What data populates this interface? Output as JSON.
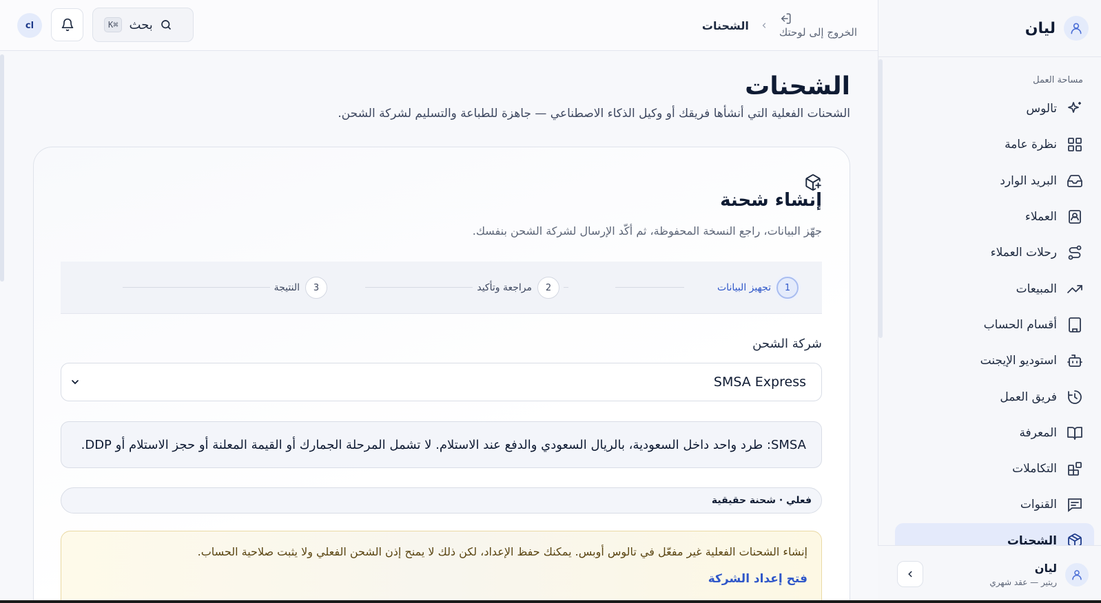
{
  "app": {
    "brand": "ليان"
  },
  "sidebar": {
    "section_label": "مساحة العمل",
    "items": [
      {
        "label": "تالوس",
        "icon": "sparkles-icon"
      },
      {
        "label": "نظرة عامة",
        "icon": "grid-icon"
      },
      {
        "label": "البريد الوارد",
        "icon": "inbox-icon"
      },
      {
        "label": "العملاء",
        "icon": "contact-icon"
      },
      {
        "label": "رحلات العملاء",
        "icon": "route-icon"
      },
      {
        "label": "المبيعات",
        "icon": "trend-up-icon"
      },
      {
        "label": "أقسام الحساب",
        "icon": "building-icon"
      },
      {
        "label": "استوديو الإيجنت",
        "icon": "bot-icon"
      },
      {
        "label": "فريق العمل",
        "icon": "history-icon"
      },
      {
        "label": "المعرفة",
        "icon": "book-icon"
      },
      {
        "label": "التكاملات",
        "icon": "blocks-icon"
      },
      {
        "label": "القنوات",
        "icon": "message-icon"
      },
      {
        "label": "الشحنات",
        "icon": "package-icon",
        "active": true
      }
    ],
    "footer": {
      "name": "ليان",
      "plan": "ريتير — عقد شهري"
    }
  },
  "topbar": {
    "avatar_initials": "cl",
    "search_label": "بحث",
    "search_shortcut": "K⌘",
    "exit_label": "الخروج إلى لوحتك",
    "breadcrumb_current": "الشحنات"
  },
  "page": {
    "title": "الشحنات",
    "subtitle": "الشحنات الفعلية التي أنشأها فريقك أو وكيل الذكاء الاصطناعي — جاهزة للطباعة والتسليم لشركة الشحن."
  },
  "create_card": {
    "title": "إنشاء شحنة",
    "subtitle": "جهّز البيانات، راجع النسخة المحفوظة، ثم أكّد الإرسال لشركة الشحن بنفسك.",
    "steps": [
      {
        "num": "1",
        "label": "تجهيز البيانات",
        "active": true
      },
      {
        "num": "2",
        "label": "مراجعة وتأكيد"
      },
      {
        "num": "3",
        "label": "النتيجة"
      }
    ],
    "carrier_label": "شركة الشحن",
    "carrier_value": "SMSA Express",
    "carrier_info": "SMSA: طرد واحد داخل السعودية، بالريال السعودي والدفع عند الاستلام. لا تشمل المرحلة الجمارك أو القيمة المعلنة أو حجز الاستلام أو DDP.",
    "mode_badge": "فعلي · شحنة حقيقية",
    "warning_text": "إنشاء الشحنات الفعلية غير مفعّل في تالوس أوبس. يمكنك حفظ الإعداد، لكن ذلك لا يمنح إذن الشحن الفعلي ولا يثبت صلاحية الحساب.",
    "warning_link": "فتح إعداد الشركة"
  },
  "colors": {
    "accent": "#2f57c9",
    "active_nav_bg": "#e4eafb",
    "warning_bg": "#fefaea",
    "warning_border": "#ead9a4"
  }
}
